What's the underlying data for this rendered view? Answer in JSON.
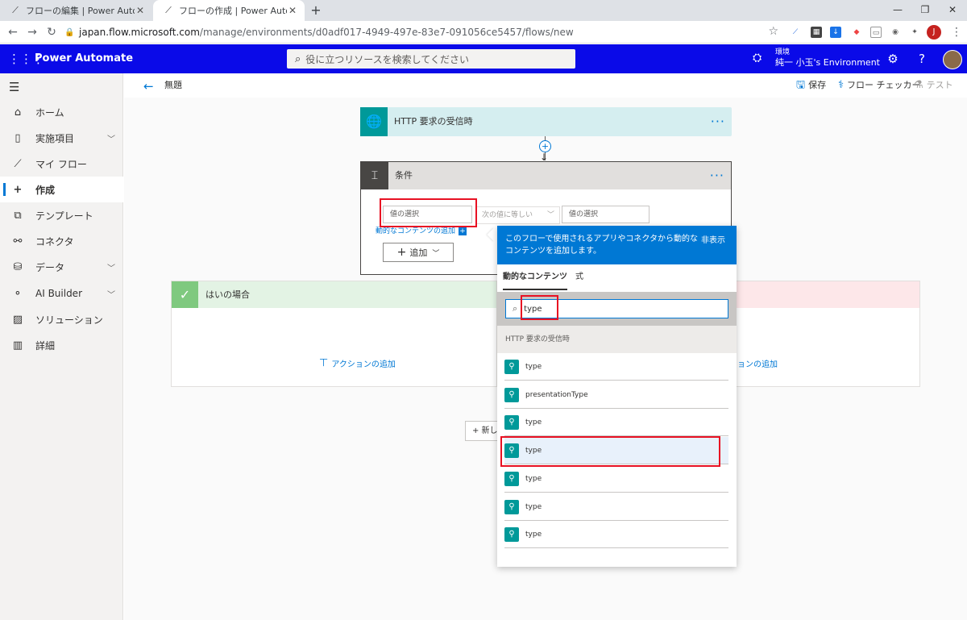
{
  "browser": {
    "tabs": [
      {
        "label": "フローの編集 | Power Automate",
        "close": "✕"
      },
      {
        "label": "フローの作成 | Power Automate",
        "close": "✕"
      }
    ],
    "new_tab": "+",
    "url_host": "japan.flow.microsoft.com",
    "url_path": "/manage/environments/d0adf017-4949-497e-83e7-091056ce5457/flows/new",
    "profile_initial": "J"
  },
  "header": {
    "app_name": "Power Automate",
    "search_placeholder": "役に立つリソースを検索してください",
    "env_label": "環境",
    "env_name": "純一 小玉's Environment"
  },
  "sidebar": {
    "items": [
      {
        "label": "ホーム",
        "icon": "home-icon"
      },
      {
        "label": "実施項目",
        "icon": "clipboard-icon",
        "expandable": true
      },
      {
        "label": "マイ フロー",
        "icon": "flow-icon"
      },
      {
        "label": "作成",
        "icon": "plus-icon",
        "active": true
      },
      {
        "label": "テンプレート",
        "icon": "template-icon"
      },
      {
        "label": "コネクタ",
        "icon": "connector-icon"
      },
      {
        "label": "データ",
        "icon": "database-icon",
        "expandable": true
      },
      {
        "label": "AI Builder",
        "icon": "ai-builder-icon",
        "expandable": true
      },
      {
        "label": "ソリューション",
        "icon": "solution-icon"
      },
      {
        "label": "詳細",
        "icon": "book-icon"
      }
    ]
  },
  "commandbar": {
    "flow_name": "無題",
    "save": "保存",
    "flow_checker": "フロー チェッカー",
    "test": "テスト"
  },
  "canvas": {
    "trigger_title": "HTTP 要求の受信時",
    "condition_title": "条件",
    "value_placeholder_left": "値の選択",
    "operator": "次の値に等しい",
    "value_placeholder_right": "値の選択",
    "add_dynamic": "動的なコンテンツの追加",
    "add_button": "追加",
    "yes_branch": "はいの場合",
    "add_action": "アクションの追加",
    "add_action_right": "ョンの追加",
    "new_step": "+ 新し"
  },
  "dynamic_panel": {
    "description": "このフローで使用されるアプリやコネクタから動的なコンテンツを追加します。",
    "hide": "非表示",
    "tab_dynamic": "動的なコンテンツ",
    "tab_expression": "式",
    "search_value": "type",
    "group_title": "HTTP 要求の受信時",
    "items": [
      {
        "label": "type"
      },
      {
        "label": "presentationType"
      },
      {
        "label": "type"
      },
      {
        "label": "type",
        "selected": true
      },
      {
        "label": "type"
      },
      {
        "label": "type"
      },
      {
        "label": "type"
      }
    ]
  },
  "colors": {
    "app_header": "#0a0ae8",
    "accent": "#0078d4",
    "trigger_icon_bg": "#009999",
    "highlight": "#e81123"
  }
}
